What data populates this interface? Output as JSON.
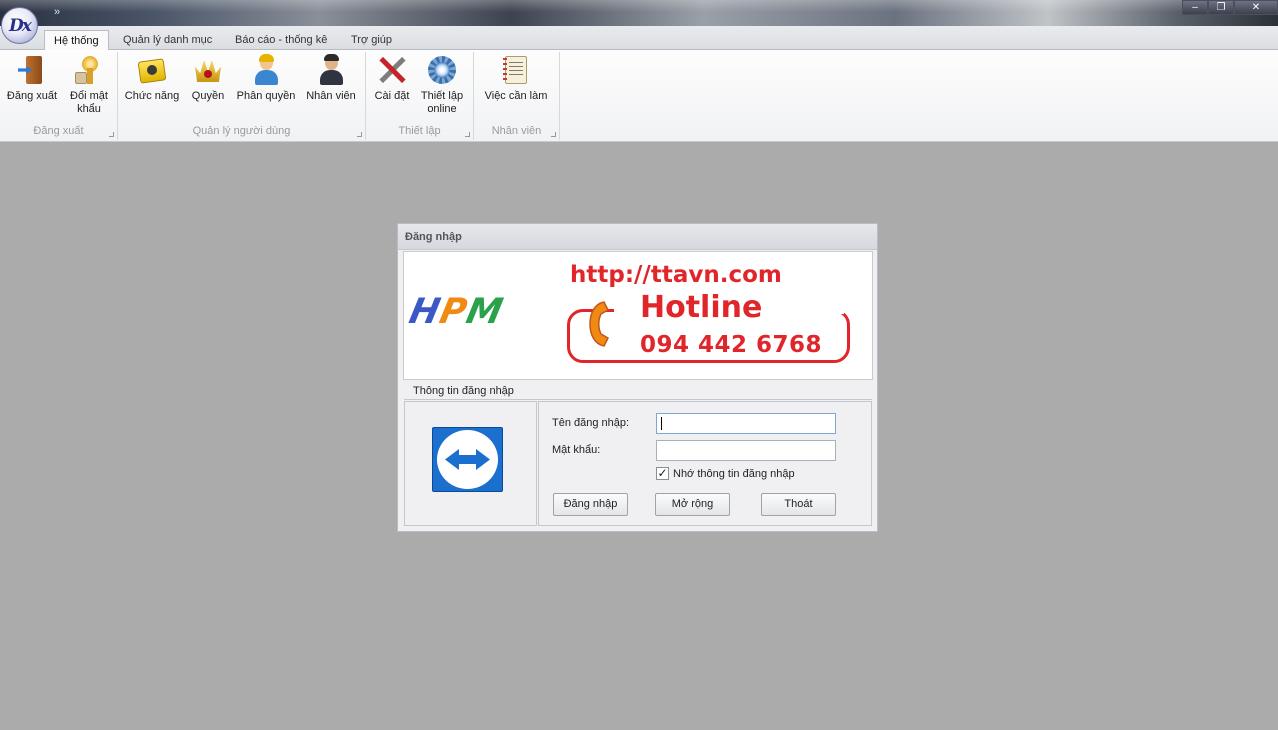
{
  "app": {
    "logo_text": "Dx",
    "qat_symbol": "»"
  },
  "window_controls": {
    "minimize": "–",
    "restore": "❐",
    "close": "✕"
  },
  "tabs": [
    {
      "label": "Hệ thống",
      "active": true
    },
    {
      "label": "Quản lý danh mục",
      "active": false
    },
    {
      "label": "Báo cáo - thống kê",
      "active": false
    },
    {
      "label": "Trợ giúp",
      "active": false
    }
  ],
  "ribbon": {
    "groups": [
      {
        "label": "Đăng xuất",
        "buttons": [
          {
            "label": "Đăng xuất",
            "icon": "logout-door-icon"
          },
          {
            "label": "Đổi mật khẩu",
            "icon": "key-icon"
          }
        ]
      },
      {
        "label": "Quản lý người dùng",
        "buttons": [
          {
            "label": "Chức năng",
            "icon": "function-icon"
          },
          {
            "label": "Quyền",
            "icon": "crown-icon"
          },
          {
            "label": "Phân quyền",
            "icon": "user-icon"
          },
          {
            "label": "Nhân viên",
            "icon": "employee-icon"
          }
        ]
      },
      {
        "label": "Thiết lập",
        "buttons": [
          {
            "label": "Cài đặt",
            "icon": "tools-icon"
          },
          {
            "label": "Thiết lập online",
            "icon": "gear-icon"
          }
        ]
      },
      {
        "label": "Nhân viên",
        "buttons": [
          {
            "label": "Việc cần làm",
            "icon": "notes-icon"
          }
        ]
      }
    ]
  },
  "login": {
    "title": "Đăng nhập",
    "banner": {
      "logo_h": "H",
      "logo_p": "P",
      "logo_m": "M",
      "url": "http://ttavn.com",
      "hotline_label": "Hotline",
      "hotline_number": "094 442 6768"
    },
    "section_title": "Thông tin đăng nhập",
    "username_label": "Tên đăng nhập:",
    "username_value": "",
    "password_label": "Mật khẩu:",
    "password_value": "",
    "remember_label": "Nhớ thông tin đăng nhập",
    "remember_checked": true,
    "login_button": "Đăng nhập",
    "expand_button": "Mở rộng",
    "exit_button": "Thoát",
    "left_icon": "teamviewer-icon"
  },
  "colors": {
    "workspace_bg": "#ababab",
    "banner_red": "#e0262a",
    "hpm_blue": "#3b58c7",
    "hpm_orange": "#f08a12",
    "hpm_green": "#2aa24a",
    "teamviewer_blue": "#1a6fcf"
  }
}
